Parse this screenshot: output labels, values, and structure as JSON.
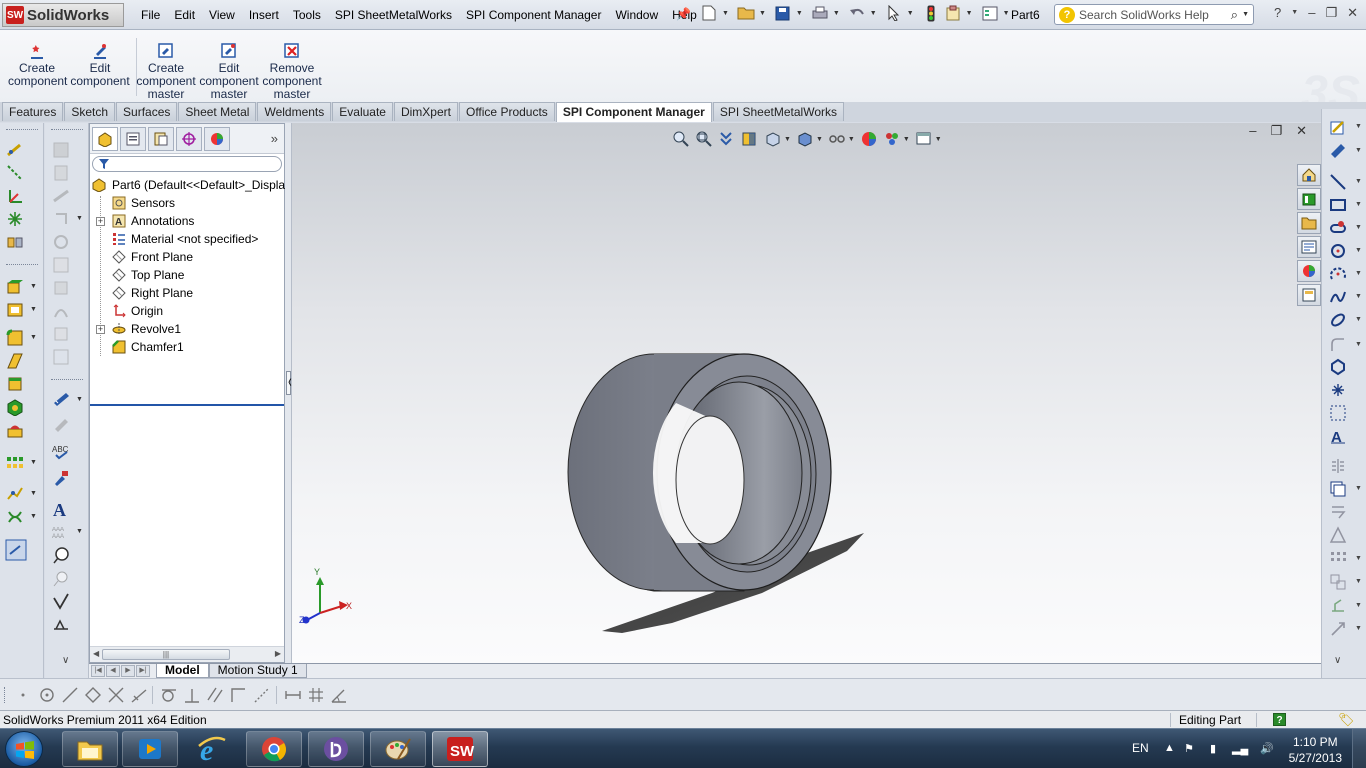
{
  "app": {
    "logo_text": "SolidWorks",
    "document_title": "Part6"
  },
  "menu": [
    "File",
    "Edit",
    "View",
    "Insert",
    "Tools",
    "SPI SheetMetalWorks",
    "SPI Component Manager",
    "Window",
    "Help"
  ],
  "search": {
    "placeholder": "Search SolidWorks Help"
  },
  "command_buttons": [
    {
      "label": "Create component",
      "icon": "create-component-icon"
    },
    {
      "label": "Edit component",
      "icon": "edit-component-icon"
    },
    {
      "label": "Create component master",
      "icon": "create-master-icon"
    },
    {
      "label": "Edit component master",
      "icon": "edit-master-icon"
    },
    {
      "label": "Remove component master",
      "icon": "remove-master-icon"
    }
  ],
  "tabs": [
    "Features",
    "Sketch",
    "Surfaces",
    "Sheet Metal",
    "Weldments",
    "Evaluate",
    "DimXpert",
    "Office Products",
    "SPI Component Manager",
    "SPI SheetMetalWorks"
  ],
  "active_tab": "SPI Component Manager",
  "feature_tree": {
    "root": "Part6  (Default<<Default>_Displa",
    "items": [
      {
        "label": "Sensors",
        "icon": "sensor-icon",
        "expandable": false
      },
      {
        "label": "Annotations",
        "icon": "annotation-icon",
        "expandable": true
      },
      {
        "label": "Material <not specified>",
        "icon": "material-icon",
        "expandable": false
      },
      {
        "label": "Front Plane",
        "icon": "plane-icon",
        "expandable": false
      },
      {
        "label": "Top Plane",
        "icon": "plane-icon",
        "expandable": false
      },
      {
        "label": "Right Plane",
        "icon": "plane-icon",
        "expandable": false
      },
      {
        "label": "Origin",
        "icon": "origin-icon",
        "expandable": false
      },
      {
        "label": "Revolve1",
        "icon": "revolve-icon",
        "expandable": true
      },
      {
        "label": "Chamfer1",
        "icon": "chamfer-icon",
        "expandable": false
      }
    ]
  },
  "model_tabs": [
    "Model",
    "Motion Study 1"
  ],
  "active_model_tab": "Model",
  "triad": {
    "x": "X",
    "y": "Y",
    "z": "Z"
  },
  "status": {
    "edition": "SolidWorks Premium 2011 x64 Edition",
    "mode": "Editing Part"
  },
  "taskbar": {
    "language": "EN",
    "time": "1:10 PM",
    "date": "5/27/2013"
  },
  "colors": {
    "accent": "#2355a8",
    "model_face": "#7d818c",
    "brand_red": "#c8201e"
  }
}
